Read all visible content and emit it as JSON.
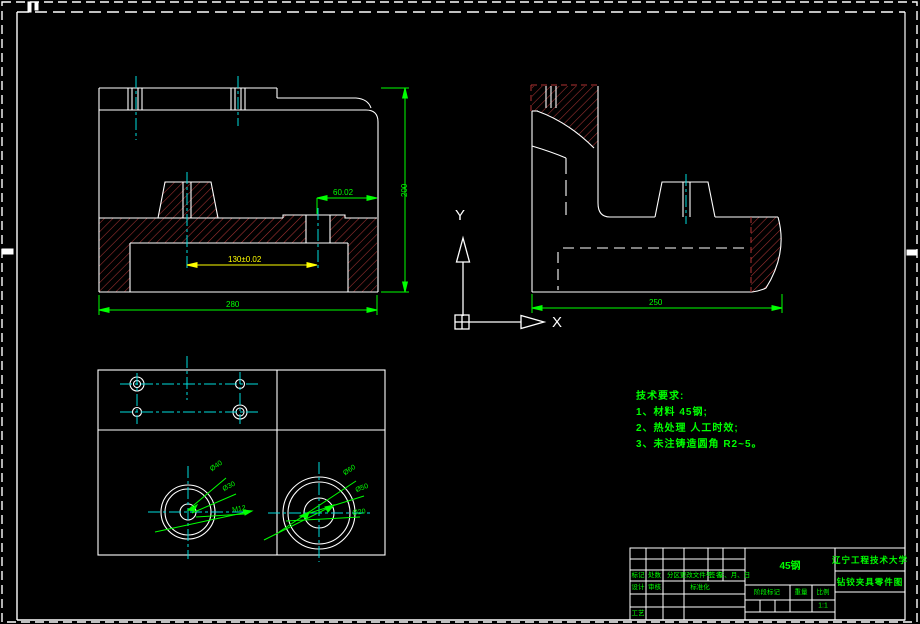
{
  "colors": {
    "background": "#000000",
    "line": "#ffffff",
    "centerline": "#00dcdc",
    "dimension": "#00ff00",
    "dimension_alt": "#ffff00",
    "hatch": "#a83434"
  },
  "ucs": {
    "x_label": "X",
    "y_label": "Y"
  },
  "notes": {
    "heading": "技术要求:",
    "line1": "1、材料 45钢;",
    "line2": "2、热处理 人工时效;",
    "line3": "3、未注铸造圆角 R2~5。"
  },
  "dimensions": {
    "front_width": "280",
    "front_height": "200",
    "front_offset": "60.02",
    "front_center": "130±0.02",
    "side_width": "250"
  },
  "hole_labels": {
    "left1": "Ø40",
    "left2": "Ø30",
    "left3": "M12",
    "right1": "Ø60",
    "right2": "Ø50",
    "right3": "Ø20"
  },
  "title_block": {
    "material": "45钢",
    "university": "辽宁工程技术大学",
    "drawing_name": "钻铰夹具零件图",
    "header_mark": "标记",
    "header_count": "处数",
    "header_zone": "分区",
    "header_file": "更改文件号",
    "header_sign": "签名",
    "header_date": "年、月、日",
    "design": "设计",
    "check": "审核",
    "standard": "标准化",
    "process": "工艺",
    "stage": "阶段标记",
    "weight": "重量",
    "scale": "比例",
    "scale_value": "1:1"
  }
}
